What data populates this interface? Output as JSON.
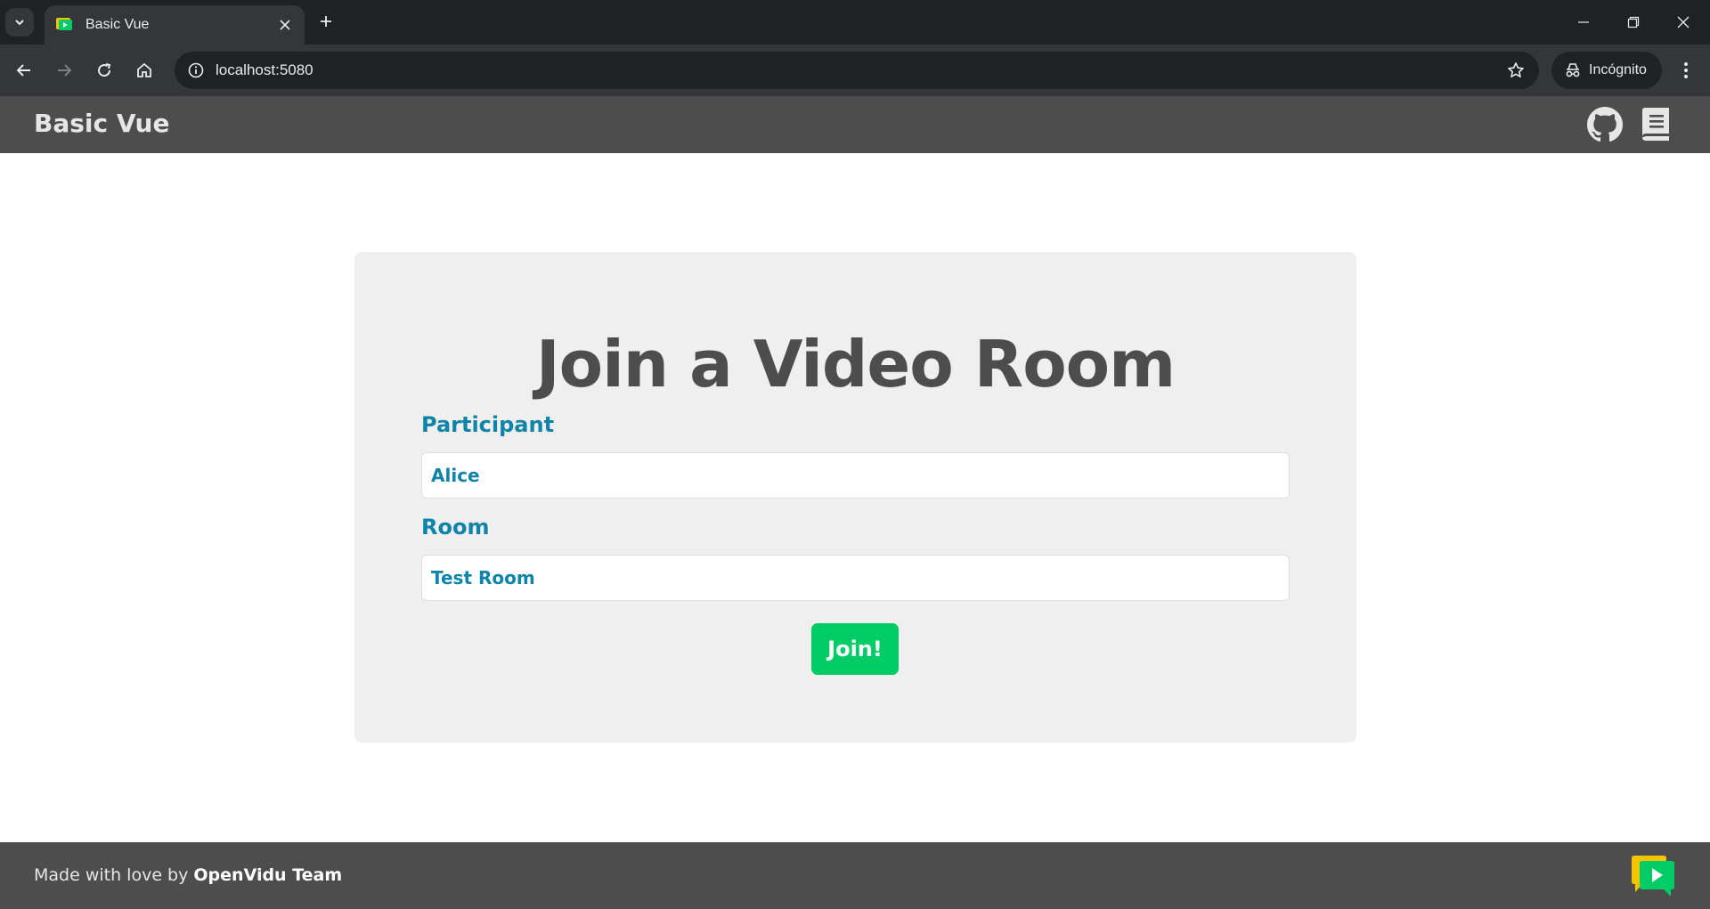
{
  "browser": {
    "tab_title": "Basic Vue",
    "url": "localhost:5080",
    "incognito_label": "Incógnito"
  },
  "header": {
    "title": "Basic Vue",
    "icons": [
      "github-icon",
      "book-icon"
    ]
  },
  "join_form": {
    "title": "Join a Video Room",
    "participant_label": "Participant",
    "participant_value": "Alice",
    "room_label": "Room",
    "room_value": "Test Room",
    "join_button": "Join!"
  },
  "footer": {
    "text_prefix": "Made with love by",
    "team_name": "OpenVidu Team"
  },
  "colors": {
    "header_bg": "#4d4d4d",
    "accent": "#0f84a8",
    "join_button": "#00cc66",
    "card_bg": "#efefef"
  }
}
